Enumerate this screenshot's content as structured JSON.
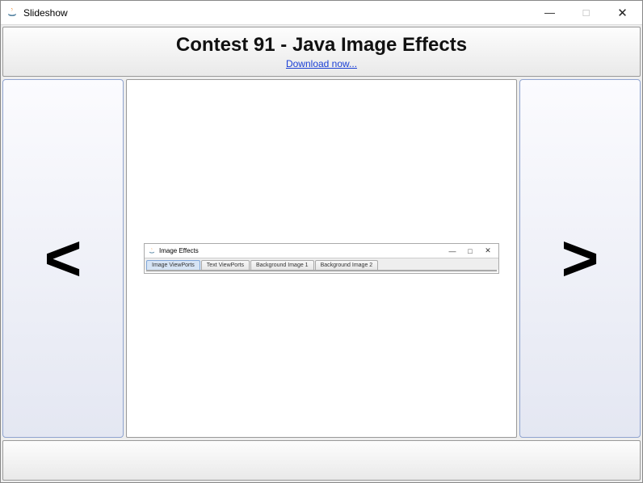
{
  "window": {
    "title": "Slideshow",
    "controls": {
      "minimize": "—",
      "maximize": "□",
      "close": "✕"
    }
  },
  "header": {
    "title": "Contest 91 - Java Image Effects",
    "link_text": "Download now..."
  },
  "nav": {
    "prev": "<",
    "next": ">"
  },
  "inner_window": {
    "title": "Image Effects",
    "controls": {
      "minimize": "—",
      "maximize": "□",
      "close": "✕"
    },
    "tabs": [
      {
        "label": "Image ViewPorts",
        "active": true
      },
      {
        "label": "Text ViewPorts",
        "active": false
      },
      {
        "label": "Background Image 1",
        "active": false
      },
      {
        "label": "Background Image 2",
        "active": false
      }
    ]
  }
}
